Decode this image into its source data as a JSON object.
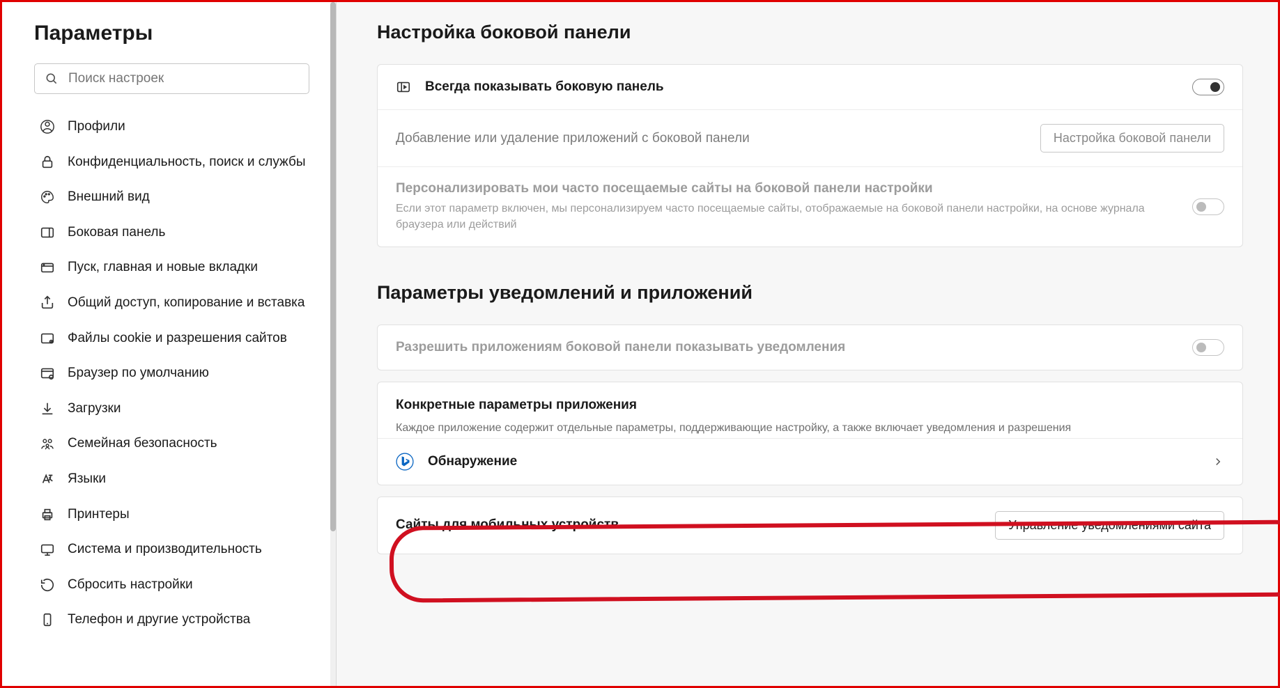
{
  "sidebar": {
    "title": "Параметры",
    "search_placeholder": "Поиск настроек",
    "items": [
      {
        "icon": "profile-icon",
        "label": "Профили"
      },
      {
        "icon": "lock-icon",
        "label": "Конфиденциальность, поиск и службы"
      },
      {
        "icon": "palette-icon",
        "label": "Внешний вид"
      },
      {
        "icon": "panel-icon",
        "label": "Боковая панель"
      },
      {
        "icon": "tab-icon",
        "label": "Пуск, главная и новые вкладки"
      },
      {
        "icon": "share-icon",
        "label": "Общий доступ, копирование и вставка"
      },
      {
        "icon": "cookie-icon",
        "label": "Файлы cookie и разрешения сайтов"
      },
      {
        "icon": "browser-icon",
        "label": "Браузер по умолчанию"
      },
      {
        "icon": "download-icon",
        "label": "Загрузки"
      },
      {
        "icon": "family-icon",
        "label": "Семейная безопасность"
      },
      {
        "icon": "language-icon",
        "label": "Языки"
      },
      {
        "icon": "printer-icon",
        "label": "Принтеры"
      },
      {
        "icon": "system-icon",
        "label": "Система и производительность"
      },
      {
        "icon": "reset-icon",
        "label": "Сбросить настройки"
      },
      {
        "icon": "phone-icon",
        "label": "Телефон и другие устройства"
      }
    ]
  },
  "main": {
    "section1": {
      "heading": "Настройка боковой панели",
      "row_always_show": {
        "label": "Всегда показывать боковую панель",
        "toggle": true
      },
      "row_add_remove": {
        "label": "Добавление или удаление приложений с боковой панели",
        "button": "Настройка боковой панели"
      },
      "row_personalize": {
        "label": "Персонализировать мои часто посещаемые сайты на боковой панели настройки",
        "desc": "Если этот параметр включен, мы персонализируем часто посещаемые сайты, отображаемые на боковой панели настройки, на основе журнала браузера или действий",
        "toggle": false
      }
    },
    "section2": {
      "heading": "Параметры уведомлений и приложений",
      "row_allow_notify": {
        "label": "Разрешить приложениям боковой панели показывать уведомления",
        "toggle": false
      },
      "specific": {
        "title": "Конкретные параметры приложения",
        "desc": "Каждое приложение содержит отдельные параметры, поддерживающие настройку, а также включает уведомления и разрешения",
        "app": {
          "label": "Обнаружение"
        }
      },
      "mobile_sites": {
        "label": "Сайты для мобильных устройств",
        "button": "Управление уведомлениями сайта"
      }
    }
  }
}
